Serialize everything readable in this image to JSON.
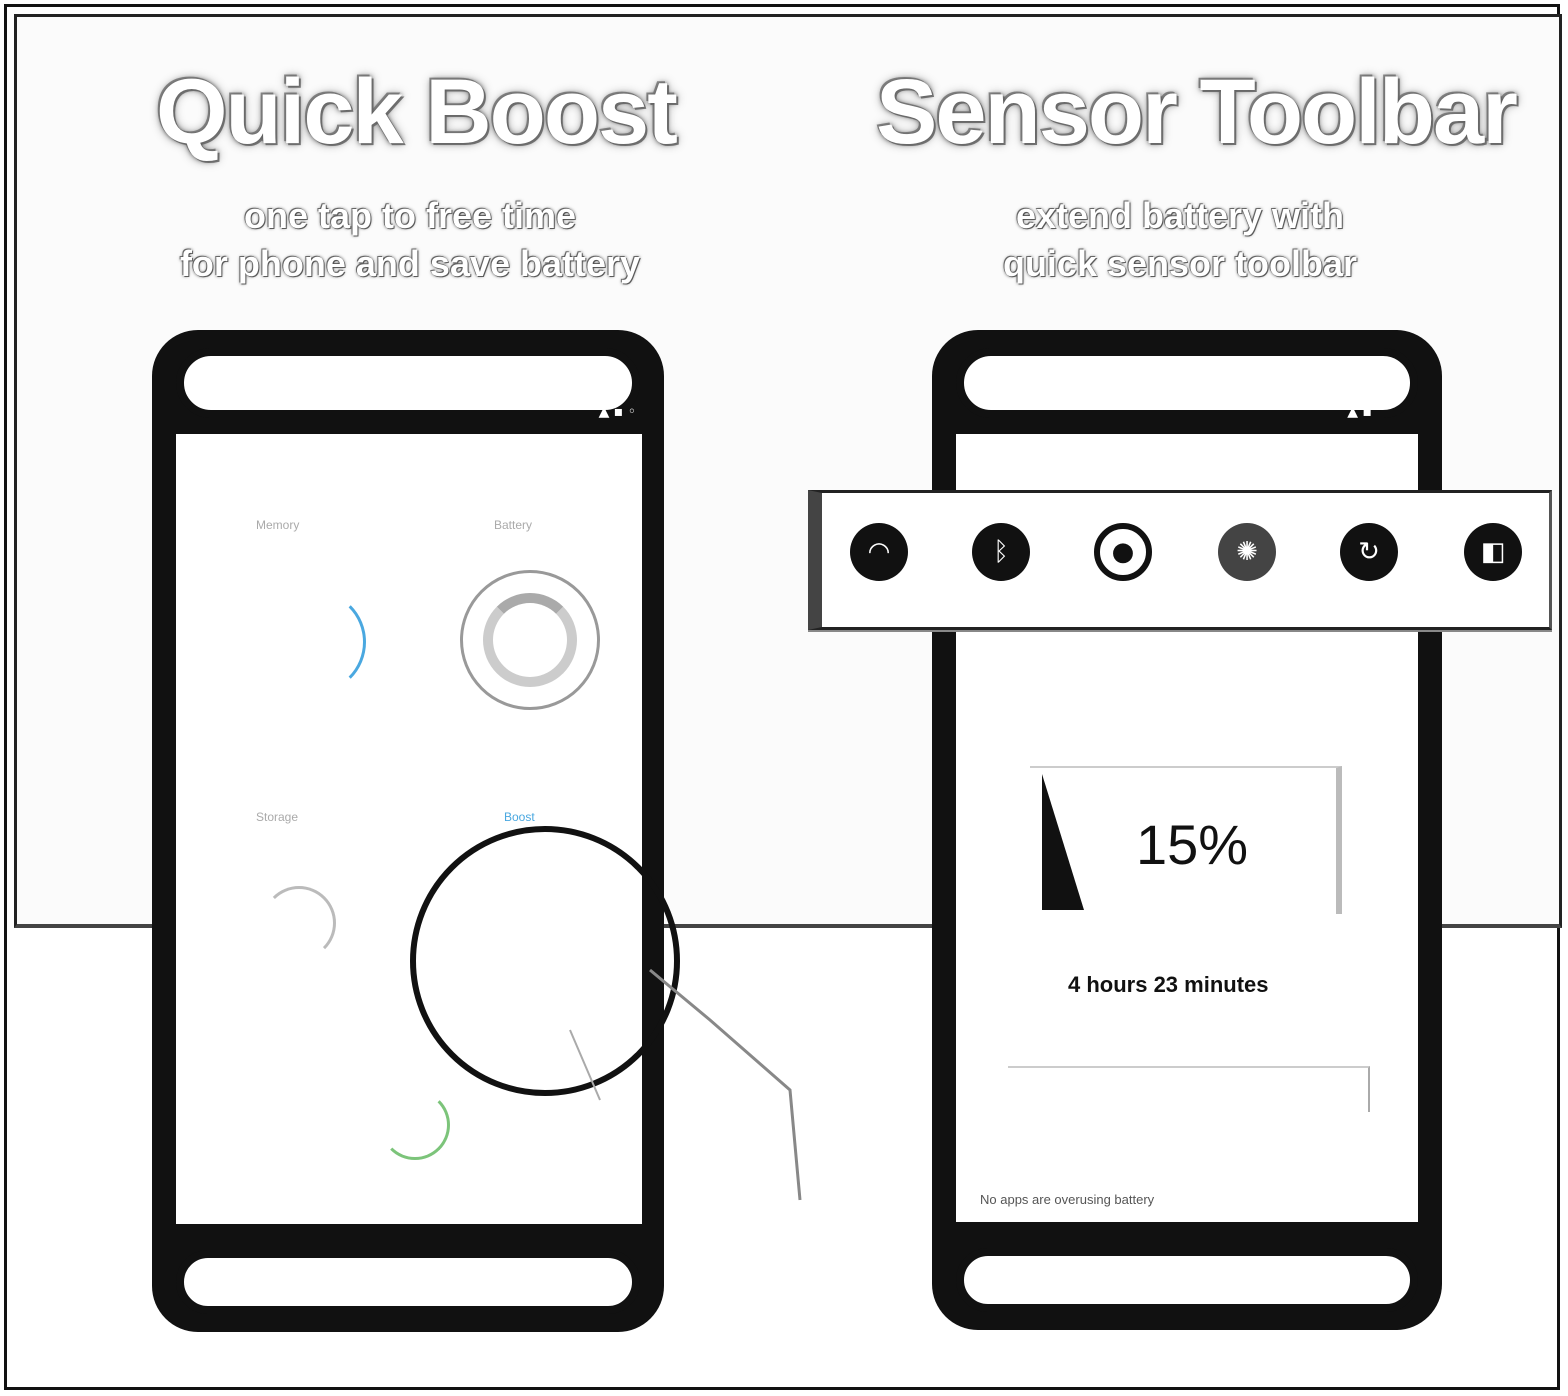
{
  "panels": [
    {
      "title": "Quick Boost",
      "subtitle_line1": "one tap to free time",
      "subtitle_line2": "for phone and save battery"
    },
    {
      "title": "Sensor Toolbar",
      "subtitle_line1": "extend battery with",
      "subtitle_line2": "quick sensor toolbar"
    }
  ],
  "left_phone": {
    "gauges": [
      {
        "label": "Memory"
      },
      {
        "label": "Battery"
      },
      {
        "label": "Storage"
      },
      {
        "label": "Boost"
      }
    ]
  },
  "sensor_toolbar": {
    "icons": [
      "wifi-icon",
      "bluetooth-icon",
      "sync-icon",
      "brightness-icon",
      "rotate-icon",
      "data-icon"
    ]
  },
  "battery": {
    "percent": "15%",
    "level": 0.15,
    "time_remaining": "4 hours 23 minutes",
    "note": "No apps are overusing battery"
  },
  "colors": {
    "accent": "#4aa8e0",
    "accent_green": "#7cc47a"
  }
}
